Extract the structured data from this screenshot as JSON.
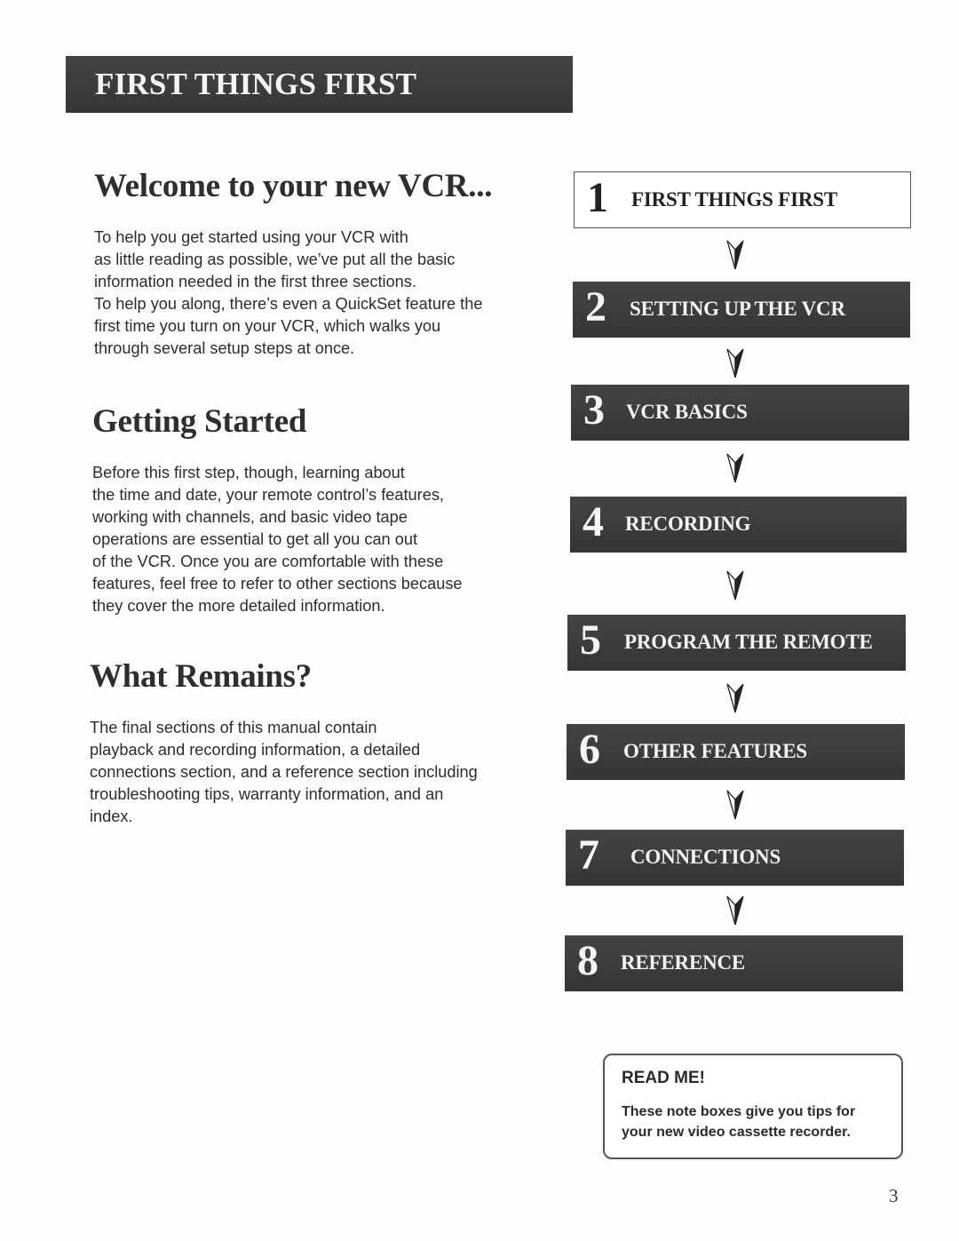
{
  "banner": {
    "title": "FIRST THINGS FIRST"
  },
  "sections": [
    {
      "heading": "Welcome to your new VCR...",
      "lines": [
        "To help you get started using your VCR with",
        "as little reading as possible, we’ve put all the basic",
        "information needed in the first three sections.",
        "To help you along, there’s even a QuickSet feature the",
        "first time you turn on your VCR, which walks you",
        "through several setup steps at once."
      ]
    },
    {
      "heading": "Getting Started",
      "lines": [
        "Before this first step, though, learning  about",
        "the time and date, your remote control’s features,",
        "working with channels, and basic video tape",
        "operations are essential to get all you can out",
        "of the VCR. Once you are comfortable with these",
        "features, feel free to refer to other sections because",
        "they cover the more detailed information."
      ]
    },
    {
      "heading": "What Remains?",
      "lines": [
        "The final sections of this manual contain",
        "playback and recording information, a detailed",
        "connections section, and a reference section including",
        "troubleshooting tips, warranty information, and an",
        "index."
      ]
    }
  ],
  "steps": [
    {
      "number": "1",
      "label": "FIRST THINGS FIRST",
      "current": true
    },
    {
      "number": "2",
      "label": "SETTING UP THE VCR",
      "current": false
    },
    {
      "number": "3",
      "label": "VCR BASICS",
      "current": false
    },
    {
      "number": "4",
      "label": "RECORDING",
      "current": false
    },
    {
      "number": "5",
      "label": "PROGRAM THE REMOTE",
      "current": false
    },
    {
      "number": "6",
      "label": "OTHER FEATURES",
      "current": false
    },
    {
      "number": "7",
      "label": "CONNECTIONS",
      "current": false
    },
    {
      "number": "8",
      "label": "REFERENCE",
      "current": false
    }
  ],
  "note": {
    "title": "READ ME!",
    "lines": [
      "These note boxes give you tips for",
      "your new video cassette recorder."
    ]
  },
  "page_number": "3"
}
